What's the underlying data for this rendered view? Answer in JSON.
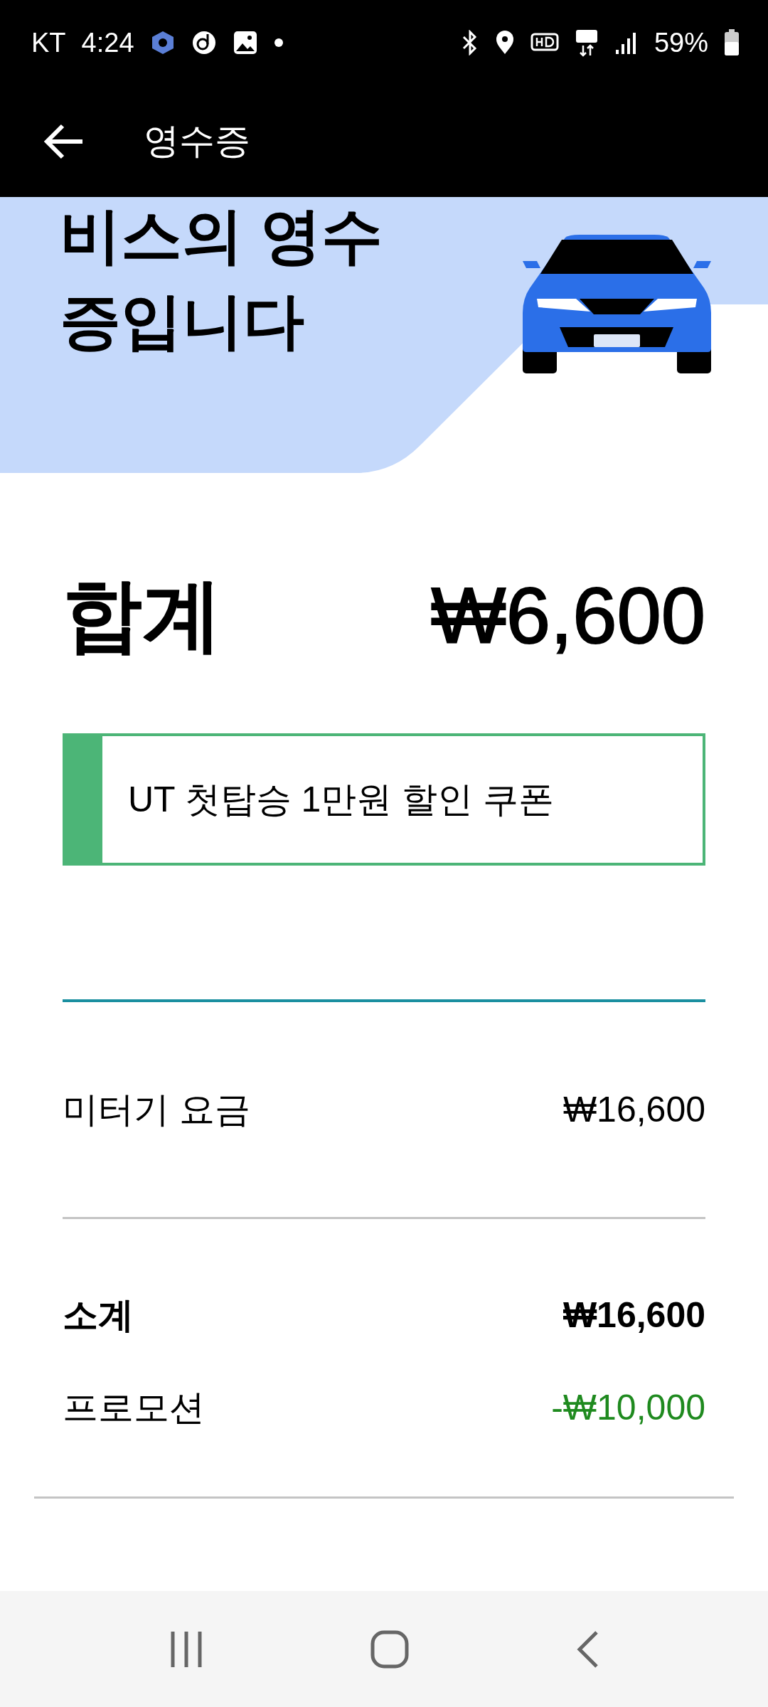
{
  "status_bar": {
    "carrier": "KT",
    "time": "4:24",
    "battery": "59%"
  },
  "app_bar": {
    "title": "영수증"
  },
  "banner": {
    "heading_lines": [
      "비스의 영수",
      "증입니다"
    ]
  },
  "total": {
    "label": "합계",
    "amount": "₩6,600"
  },
  "coupon": {
    "text": "UT 첫탑승 1만원 할인 쿠폰"
  },
  "fare_rows": [
    {
      "label": "미터기 요금",
      "value": "₩16,600"
    }
  ],
  "summary_rows": [
    {
      "label": "소계",
      "value": "₩16,600",
      "kind": "bold"
    },
    {
      "label": "프로모션",
      "value": "-₩10,000",
      "kind": "discount"
    }
  ]
}
